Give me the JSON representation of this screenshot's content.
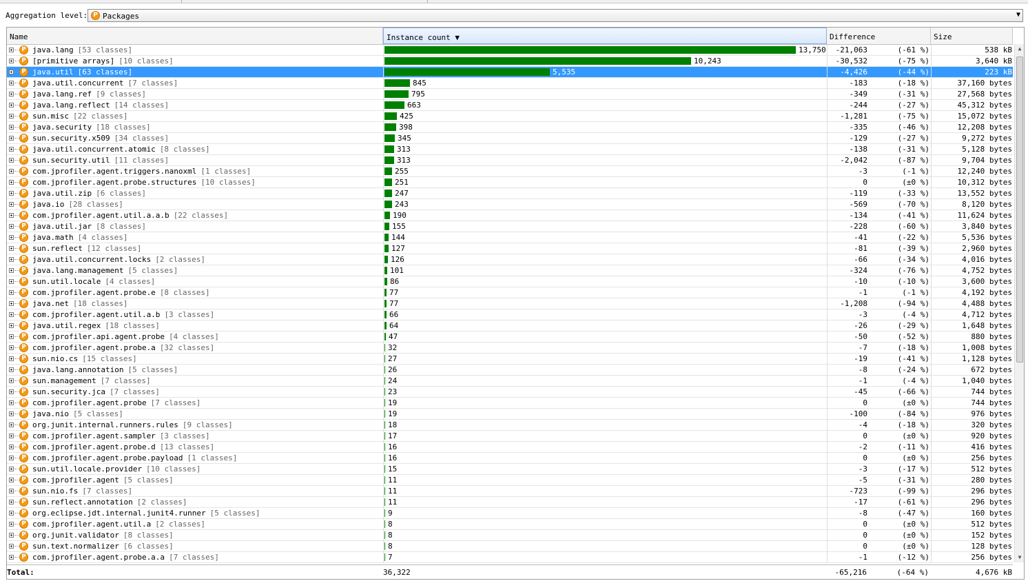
{
  "aggregation": {
    "label": "Aggregation level:",
    "selected": "Packages"
  },
  "columns": {
    "name": "Name",
    "instance_count": "Instance count",
    "sort_arrow": "▼",
    "difference": "Difference",
    "size": "Size"
  },
  "max_count": 13750,
  "colors": {
    "bar": "#008000",
    "selection": "#3399ff",
    "package_icon": "#f39a16"
  },
  "rows": [
    {
      "pkg": "java.lang",
      "cls": "[53 classes]",
      "count": 13750,
      "count_label": "13,750",
      "diff": "-21,063",
      "pct": "(-61 %)",
      "size": "538 kB"
    },
    {
      "pkg": "[primitive arrays]",
      "cls": "[10 classes]",
      "count": 10243,
      "count_label": "10,243",
      "diff": "-30,532",
      "pct": "(-75 %)",
      "size": "3,640 kB"
    },
    {
      "pkg": "java.util",
      "cls": "[63 classes]",
      "count": 5535,
      "count_label": "5,535",
      "diff": "-4,426",
      "pct": "(-44 %)",
      "size": "223 kB",
      "selected": true
    },
    {
      "pkg": "java.util.concurrent",
      "cls": "[7 classes]",
      "count": 845,
      "count_label": "845",
      "diff": "-183",
      "pct": "(-18 %)",
      "size": "37,160 bytes"
    },
    {
      "pkg": "java.lang.ref",
      "cls": "[9 classes]",
      "count": 795,
      "count_label": "795",
      "diff": "-349",
      "pct": "(-31 %)",
      "size": "27,568 bytes"
    },
    {
      "pkg": "java.lang.reflect",
      "cls": "[14 classes]",
      "count": 663,
      "count_label": "663",
      "diff": "-244",
      "pct": "(-27 %)",
      "size": "45,312 bytes"
    },
    {
      "pkg": "sun.misc",
      "cls": "[22 classes]",
      "count": 425,
      "count_label": "425",
      "diff": "-1,281",
      "pct": "(-75 %)",
      "size": "15,072 bytes"
    },
    {
      "pkg": "java.security",
      "cls": "[18 classes]",
      "count": 398,
      "count_label": "398",
      "diff": "-335",
      "pct": "(-46 %)",
      "size": "12,208 bytes"
    },
    {
      "pkg": "sun.security.x509",
      "cls": "[34 classes]",
      "count": 345,
      "count_label": "345",
      "diff": "-129",
      "pct": "(-27 %)",
      "size": "9,272 bytes"
    },
    {
      "pkg": "java.util.concurrent.atomic",
      "cls": "[8 classes]",
      "count": 313,
      "count_label": "313",
      "diff": "-138",
      "pct": "(-31 %)",
      "size": "5,128 bytes"
    },
    {
      "pkg": "sun.security.util",
      "cls": "[11 classes]",
      "count": 313,
      "count_label": "313",
      "diff": "-2,042",
      "pct": "(-87 %)",
      "size": "9,704 bytes"
    },
    {
      "pkg": "com.jprofiler.agent.triggers.nanoxml",
      "cls": "[1 classes]",
      "count": 255,
      "count_label": "255",
      "diff": "-3",
      "pct": "(-1 %)",
      "size": "12,240 bytes"
    },
    {
      "pkg": "com.jprofiler.agent.probe.structures",
      "cls": "[10 classes]",
      "count": 251,
      "count_label": "251",
      "diff": "0",
      "pct": "(±0 %)",
      "size": "10,312 bytes"
    },
    {
      "pkg": "java.util.zip",
      "cls": "[6 classes]",
      "count": 247,
      "count_label": "247",
      "diff": "-119",
      "pct": "(-33 %)",
      "size": "13,552 bytes"
    },
    {
      "pkg": "java.io",
      "cls": "[28 classes]",
      "count": 243,
      "count_label": "243",
      "diff": "-569",
      "pct": "(-70 %)",
      "size": "8,120 bytes"
    },
    {
      "pkg": "com.jprofiler.agent.util.a.a.b",
      "cls": "[22 classes]",
      "count": 190,
      "count_label": "190",
      "diff": "-134",
      "pct": "(-41 %)",
      "size": "11,624 bytes"
    },
    {
      "pkg": "java.util.jar",
      "cls": "[8 classes]",
      "count": 155,
      "count_label": "155",
      "diff": "-228",
      "pct": "(-60 %)",
      "size": "3,840 bytes"
    },
    {
      "pkg": "java.math",
      "cls": "[4 classes]",
      "count": 144,
      "count_label": "144",
      "diff": "-41",
      "pct": "(-22 %)",
      "size": "5,536 bytes"
    },
    {
      "pkg": "sun.reflect",
      "cls": "[12 classes]",
      "count": 127,
      "count_label": "127",
      "diff": "-81",
      "pct": "(-39 %)",
      "size": "2,960 bytes"
    },
    {
      "pkg": "java.util.concurrent.locks",
      "cls": "[2 classes]",
      "count": 126,
      "count_label": "126",
      "diff": "-66",
      "pct": "(-34 %)",
      "size": "4,016 bytes"
    },
    {
      "pkg": "java.lang.management",
      "cls": "[5 classes]",
      "count": 101,
      "count_label": "101",
      "diff": "-324",
      "pct": "(-76 %)",
      "size": "4,752 bytes"
    },
    {
      "pkg": "sun.util.locale",
      "cls": "[4 classes]",
      "count": 86,
      "count_label": "86",
      "diff": "-10",
      "pct": "(-10 %)",
      "size": "3,600 bytes"
    },
    {
      "pkg": "com.jprofiler.agent.probe.e",
      "cls": "[8 classes]",
      "count": 77,
      "count_label": "77",
      "diff": "-1",
      "pct": "(-1 %)",
      "size": "4,192 bytes"
    },
    {
      "pkg": "java.net",
      "cls": "[18 classes]",
      "count": 77,
      "count_label": "77",
      "diff": "-1,208",
      "pct": "(-94 %)",
      "size": "4,488 bytes"
    },
    {
      "pkg": "com.jprofiler.agent.util.a.b",
      "cls": "[3 classes]",
      "count": 66,
      "count_label": "66",
      "diff": "-3",
      "pct": "(-4 %)",
      "size": "4,712 bytes"
    },
    {
      "pkg": "java.util.regex",
      "cls": "[18 classes]",
      "count": 64,
      "count_label": "64",
      "diff": "-26",
      "pct": "(-29 %)",
      "size": "1,648 bytes"
    },
    {
      "pkg": "com.jprofiler.api.agent.probe",
      "cls": "[4 classes]",
      "count": 47,
      "count_label": "47",
      "diff": "-50",
      "pct": "(-52 %)",
      "size": "880 bytes"
    },
    {
      "pkg": "com.jprofiler.agent.probe.a",
      "cls": "[32 classes]",
      "count": 32,
      "count_label": "32",
      "diff": "-7",
      "pct": "(-18 %)",
      "size": "1,008 bytes"
    },
    {
      "pkg": "sun.nio.cs",
      "cls": "[15 classes]",
      "count": 27,
      "count_label": "27",
      "diff": "-19",
      "pct": "(-41 %)",
      "size": "1,128 bytes"
    },
    {
      "pkg": "java.lang.annotation",
      "cls": "[5 classes]",
      "count": 26,
      "count_label": "26",
      "diff": "-8",
      "pct": "(-24 %)",
      "size": "672 bytes"
    },
    {
      "pkg": "sun.management",
      "cls": "[7 classes]",
      "count": 24,
      "count_label": "24",
      "diff": "-1",
      "pct": "(-4 %)",
      "size": "1,040 bytes"
    },
    {
      "pkg": "sun.security.jca",
      "cls": "[7 classes]",
      "count": 23,
      "count_label": "23",
      "diff": "-45",
      "pct": "(-66 %)",
      "size": "744 bytes"
    },
    {
      "pkg": "com.jprofiler.agent.probe",
      "cls": "[7 classes]",
      "count": 19,
      "count_label": "19",
      "diff": "0",
      "pct": "(±0 %)",
      "size": "744 bytes"
    },
    {
      "pkg": "java.nio",
      "cls": "[5 classes]",
      "count": 19,
      "count_label": "19",
      "diff": "-100",
      "pct": "(-84 %)",
      "size": "976 bytes"
    },
    {
      "pkg": "org.junit.internal.runners.rules",
      "cls": "[9 classes]",
      "count": 18,
      "count_label": "18",
      "diff": "-4",
      "pct": "(-18 %)",
      "size": "320 bytes"
    },
    {
      "pkg": "com.jprofiler.agent.sampler",
      "cls": "[3 classes]",
      "count": 17,
      "count_label": "17",
      "diff": "0",
      "pct": "(±0 %)",
      "size": "920 bytes"
    },
    {
      "pkg": "com.jprofiler.agent.probe.d",
      "cls": "[13 classes]",
      "count": 16,
      "count_label": "16",
      "diff": "-2",
      "pct": "(-11 %)",
      "size": "416 bytes"
    },
    {
      "pkg": "com.jprofiler.agent.probe.payload",
      "cls": "[1 classes]",
      "count": 16,
      "count_label": "16",
      "diff": "0",
      "pct": "(±0 %)",
      "size": "256 bytes"
    },
    {
      "pkg": "sun.util.locale.provider",
      "cls": "[10 classes]",
      "count": 15,
      "count_label": "15",
      "diff": "-3",
      "pct": "(-17 %)",
      "size": "512 bytes"
    },
    {
      "pkg": "com.jprofiler.agent",
      "cls": "[5 classes]",
      "count": 11,
      "count_label": "11",
      "diff": "-5",
      "pct": "(-31 %)",
      "size": "280 bytes"
    },
    {
      "pkg": "sun.nio.fs",
      "cls": "[7 classes]",
      "count": 11,
      "count_label": "11",
      "diff": "-723",
      "pct": "(-99 %)",
      "size": "296 bytes"
    },
    {
      "pkg": "sun.reflect.annotation",
      "cls": "[2 classes]",
      "count": 11,
      "count_label": "11",
      "diff": "-17",
      "pct": "(-61 %)",
      "size": "296 bytes"
    },
    {
      "pkg": "org.eclipse.jdt.internal.junit4.runner",
      "cls": "[5 classes]",
      "count": 9,
      "count_label": "9",
      "diff": "-8",
      "pct": "(-47 %)",
      "size": "160 bytes"
    },
    {
      "pkg": "com.jprofiler.agent.util.a",
      "cls": "[2 classes]",
      "count": 8,
      "count_label": "8",
      "diff": "0",
      "pct": "(±0 %)",
      "size": "512 bytes"
    },
    {
      "pkg": "org.junit.validator",
      "cls": "[8 classes]",
      "count": 8,
      "count_label": "8",
      "diff": "0",
      "pct": "(±0 %)",
      "size": "152 bytes"
    },
    {
      "pkg": "sun.text.normalizer",
      "cls": "[6 classes]",
      "count": 8,
      "count_label": "8",
      "diff": "0",
      "pct": "(±0 %)",
      "size": "128 bytes"
    },
    {
      "pkg": "com.jprofiler.agent.probe.a.a",
      "cls": "[7 classes]",
      "count": 7,
      "count_label": "7",
      "diff": "-1",
      "pct": "(-12 %)",
      "size": "256 bytes"
    }
  ],
  "total": {
    "label": "Total:",
    "count": "36,322",
    "diff": "-65,216",
    "pct": "(-64 %)",
    "size": "4,676 kB"
  }
}
